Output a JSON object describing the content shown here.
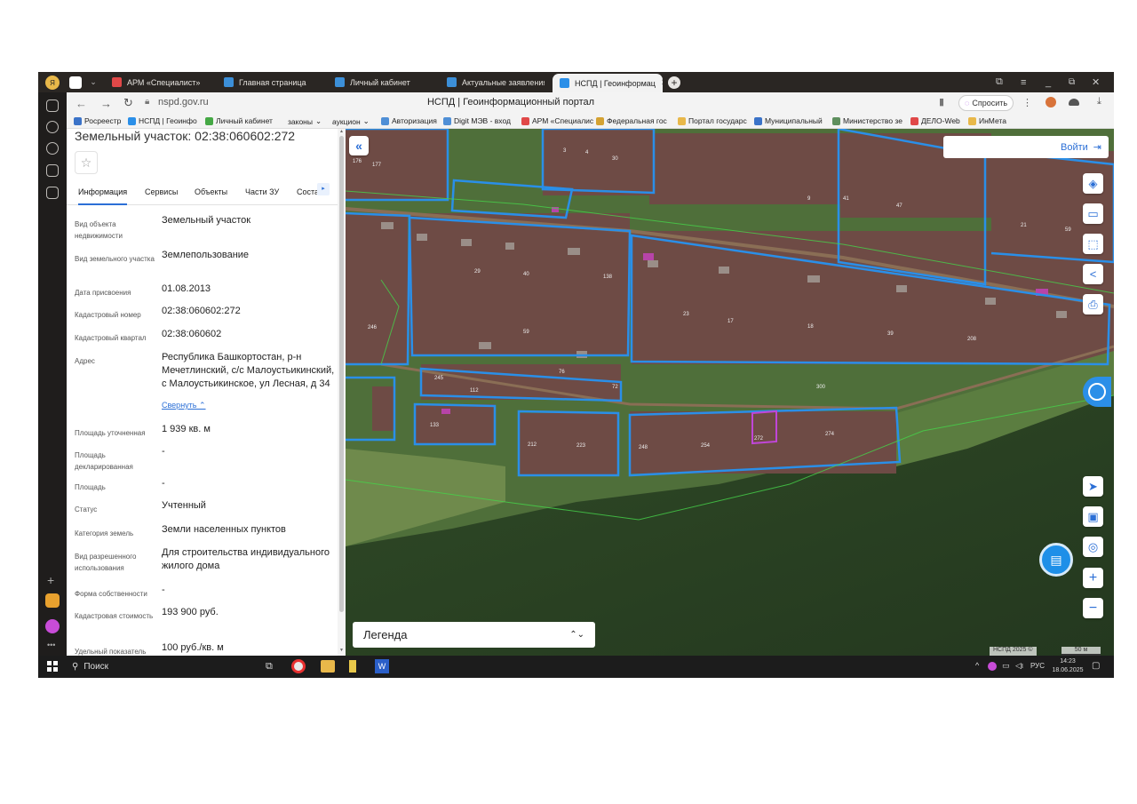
{
  "browser": {
    "tabs": [
      {
        "label": "АРМ «Специалист»",
        "color": "#e04848"
      },
      {
        "label": "Главная страница",
        "color": "#3c8fd8"
      },
      {
        "label": "Личный кабинет",
        "color": "#3c8fd8"
      },
      {
        "label": "Актуальные заявления",
        "color": "#3c8fd8"
      },
      {
        "label": "НСПД | Геоинформац",
        "color": "#2b8fe8"
      }
    ],
    "active_tab_index": 4,
    "url": "nspd.gov.ru",
    "page_title": "НСПД | Геоинформационный портал",
    "ask_label": "Спросить",
    "bookmarks": [
      {
        "label": "Росреестр",
        "color": "#3b73c8"
      },
      {
        "label": "НСПД | Геоинфо",
        "color": "#2b8fe8"
      },
      {
        "label": "Личный кабинет",
        "color": "#45a845"
      },
      {
        "label": "законы",
        "color": ""
      },
      {
        "label": "аукцион",
        "color": ""
      },
      {
        "label": "Авторизация",
        "color": "#4f8fd6"
      },
      {
        "label": "Digit МЭВ - вход",
        "color": "#4f8fd6"
      },
      {
        "label": "АРМ «Специалис",
        "color": "#e04848"
      },
      {
        "label": "Федеральная гос",
        "color": "#d4a232"
      },
      {
        "label": "Портал государс",
        "color": "#e8b84a"
      },
      {
        "label": "Муниципальный",
        "color": "#3b73c8"
      },
      {
        "label": "Министерство зе",
        "color": "#5e8f5e"
      },
      {
        "label": "ДЕЛО-Web",
        "color": "#e04848"
      },
      {
        "label": "ИнМета",
        "color": "#e8b84a"
      }
    ]
  },
  "panel": {
    "title": "Земельный участок: 02:38:060602:272",
    "tabs": [
      "Информация",
      "Сервисы",
      "Объекты",
      "Части ЗУ",
      "Соста"
    ],
    "active_tab": 0,
    "fields": [
      {
        "label": "Вид объекта недвижимости",
        "value": "Земельный участок"
      },
      {
        "label": "Вид земельного участка",
        "value": "Землепользование"
      },
      {
        "label": "Дата присвоения",
        "value": "01.08.2013"
      },
      {
        "label": "Кадастровый номер",
        "value": "02:38:060602:272"
      },
      {
        "label": "Кадастровый квартал",
        "value": "02:38:060602"
      },
      {
        "label": "Адрес",
        "value": "Республика Башкортостан, р-н Мечетлинский, с/с Малоустьикинский, с Малоустьикинское, ул Лесная, д 34"
      },
      {
        "label": "Площадь уточненная",
        "value": "1 939 кв. м"
      },
      {
        "label": "Площадь декларированная",
        "value": "-"
      },
      {
        "label": "Площадь",
        "value": "-"
      },
      {
        "label": "Статус",
        "value": "Учтенный"
      },
      {
        "label": "Категория земель",
        "value": "Земли населенных пунктов"
      },
      {
        "label": "Вид разрешенного использования",
        "value": "Для строительства индивидуального жилого дома"
      },
      {
        "label": "Форма собственности",
        "value": "-"
      },
      {
        "label": "Кадастровая стоимость",
        "value": "193 900 руб."
      },
      {
        "label": "Удельный показатель",
        "value": "100 руб./кв. м"
      }
    ],
    "collapse_label": "Свернуть"
  },
  "map": {
    "login_label": "Войти",
    "legend_label": "Легенда",
    "attribution": "НСПД 2025 ©",
    "scale_label": "50 м"
  },
  "taskbar": {
    "search_placeholder": "Поиск",
    "lang": "РУС",
    "time": "14:23",
    "date": "18.06.2025"
  }
}
